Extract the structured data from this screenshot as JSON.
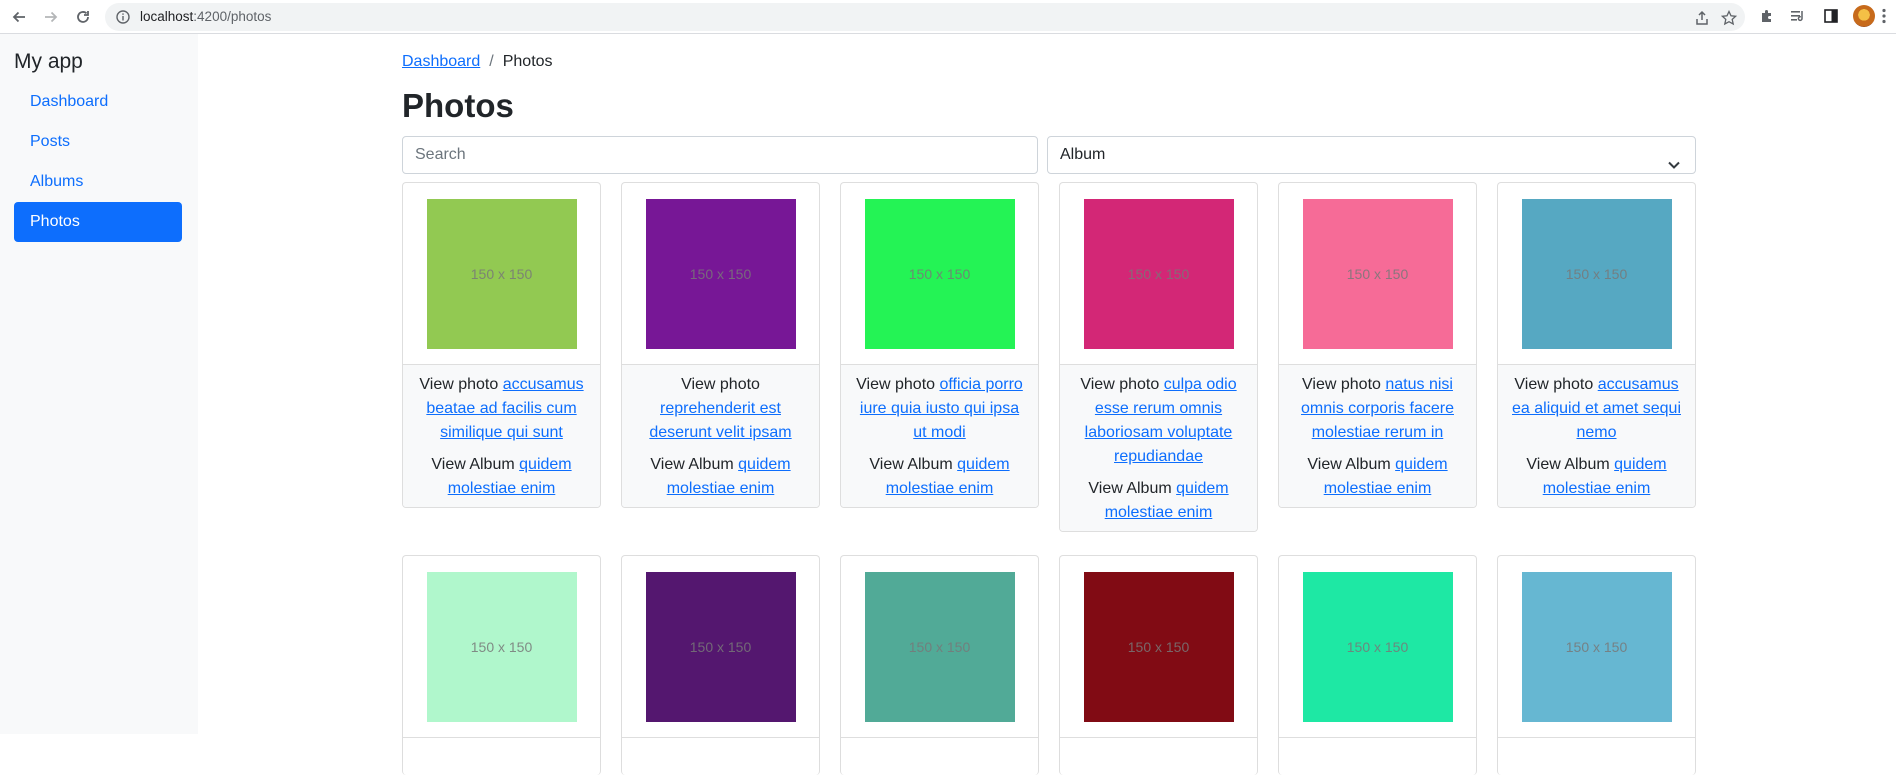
{
  "browser": {
    "url_host": "localhost",
    "url_path": ":4200/photos"
  },
  "sidebar": {
    "brand": "My app",
    "items": [
      {
        "label": "Dashboard",
        "active": false
      },
      {
        "label": "Posts",
        "active": false
      },
      {
        "label": "Albums",
        "active": false
      },
      {
        "label": "Photos",
        "active": true
      }
    ]
  },
  "breadcrumb": {
    "home": "Dashboard",
    "separator": "/",
    "current": "Photos"
  },
  "page": {
    "title": "Photos"
  },
  "filters": {
    "search_placeholder": "Search",
    "album_select_value": "Album"
  },
  "labels": {
    "view_photo": "View photo",
    "view_album": "View Album"
  },
  "photos": [
    {
      "color": "#92c952",
      "size_text": "150 x 150",
      "title": "accusamus beatae ad facilis cum similique qui sunt",
      "album": "quidem molestiae enim"
    },
    {
      "color": "#771796",
      "size_text": "150 x 150",
      "title": "reprehenderit est deserunt velit ipsam",
      "album": "quidem molestiae enim"
    },
    {
      "color": "#24f355",
      "size_text": "150 x 150",
      "title": "officia porro iure quia iusto qui ipsa ut modi",
      "album": "quidem molestiae enim"
    },
    {
      "color": "#d32776",
      "size_text": "150 x 150",
      "title": "culpa odio esse rerum omnis laboriosam voluptate repudiandae",
      "album": "quidem molestiae enim"
    },
    {
      "color": "#f66b97",
      "size_text": "150 x 150",
      "title": "natus nisi omnis corporis facere molestiae rerum in",
      "album": "quidem molestiae enim"
    },
    {
      "color": "#56a8c2",
      "size_text": "150 x 150",
      "title": "accusamus ea aliquid et amet sequi nemo",
      "album": "quidem molestiae enim"
    },
    {
      "color": "#b0f7cc",
      "size_text": "150 x 150"
    },
    {
      "color": "#54176f",
      "size_text": "150 x 150"
    },
    {
      "color": "#51aa97",
      "size_text": "150 x 150"
    },
    {
      "color": "#810b14",
      "size_text": "150 x 150"
    },
    {
      "color": "#1ee8a4",
      "size_text": "150 x 150"
    },
    {
      "color": "#66b7d2",
      "size_text": "150 x 150"
    }
  ]
}
